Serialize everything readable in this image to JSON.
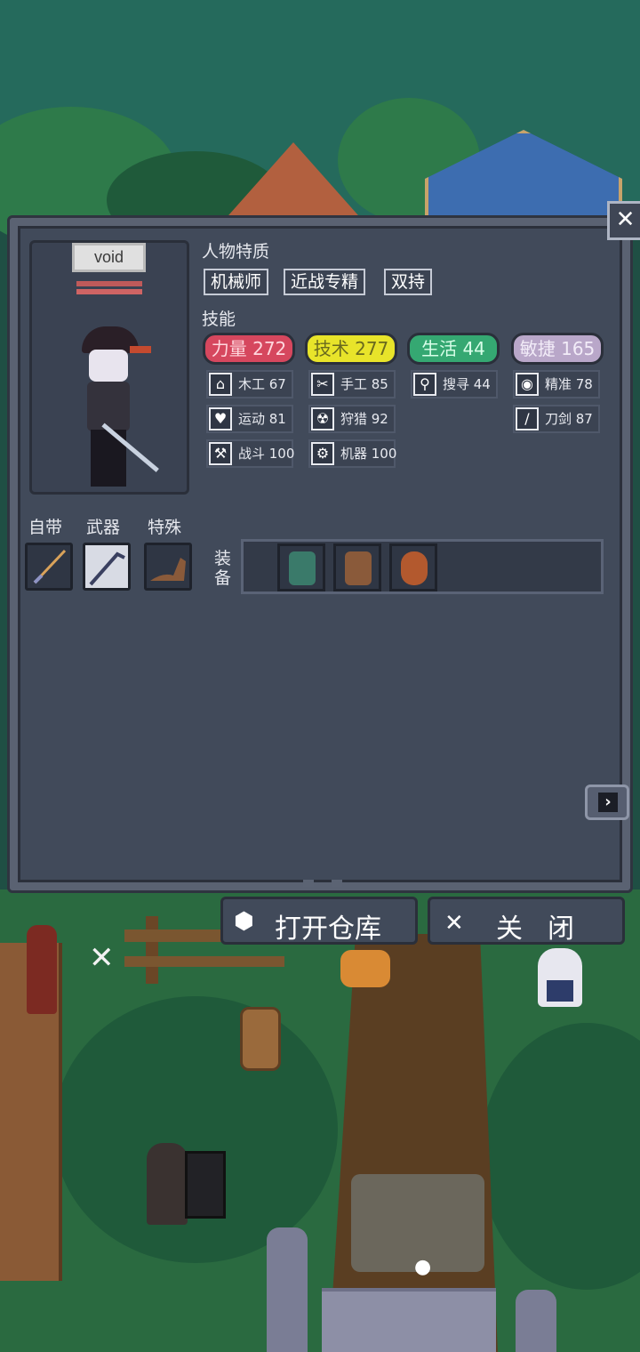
{
  "character": {
    "name": "void"
  },
  "traits": {
    "title": "人物特质",
    "items": [
      "机械师",
      "近战专精",
      "双持"
    ]
  },
  "skills": {
    "title": "技能",
    "categories": [
      {
        "label": "力量 272",
        "color": "#d6475e"
      },
      {
        "label": "技术 277",
        "color": "#e8e42a"
      },
      {
        "label": "生活 44",
        "color": "#35a872"
      },
      {
        "label": "敏捷 165",
        "color": "#b9a7c9"
      }
    ],
    "sub": [
      {
        "label": "木工 67",
        "icon": "house-icon"
      },
      {
        "label": "手工 85",
        "icon": "scissors-icon"
      },
      {
        "label": "搜寻 44",
        "icon": "magnifier-icon"
      },
      {
        "label": "精准 78",
        "icon": "eye-icon"
      },
      {
        "label": "运动 81",
        "icon": "heart-icon"
      },
      {
        "label": "狩猎 92",
        "icon": "radiation-icon"
      },
      {
        "label": "刀剑 87",
        "icon": "sword-icon"
      },
      {
        "label": "战斗 100",
        "icon": "hammer-icon"
      },
      {
        "label": "机器 100",
        "icon": "gear-icon"
      }
    ]
  },
  "slots": {
    "builtin_label": "自带",
    "weapon_label": "武器",
    "special_label": "特殊",
    "equipment_label": "装\n备"
  },
  "buttons": {
    "open_storage": "打开仓库",
    "close": "关闭"
  }
}
